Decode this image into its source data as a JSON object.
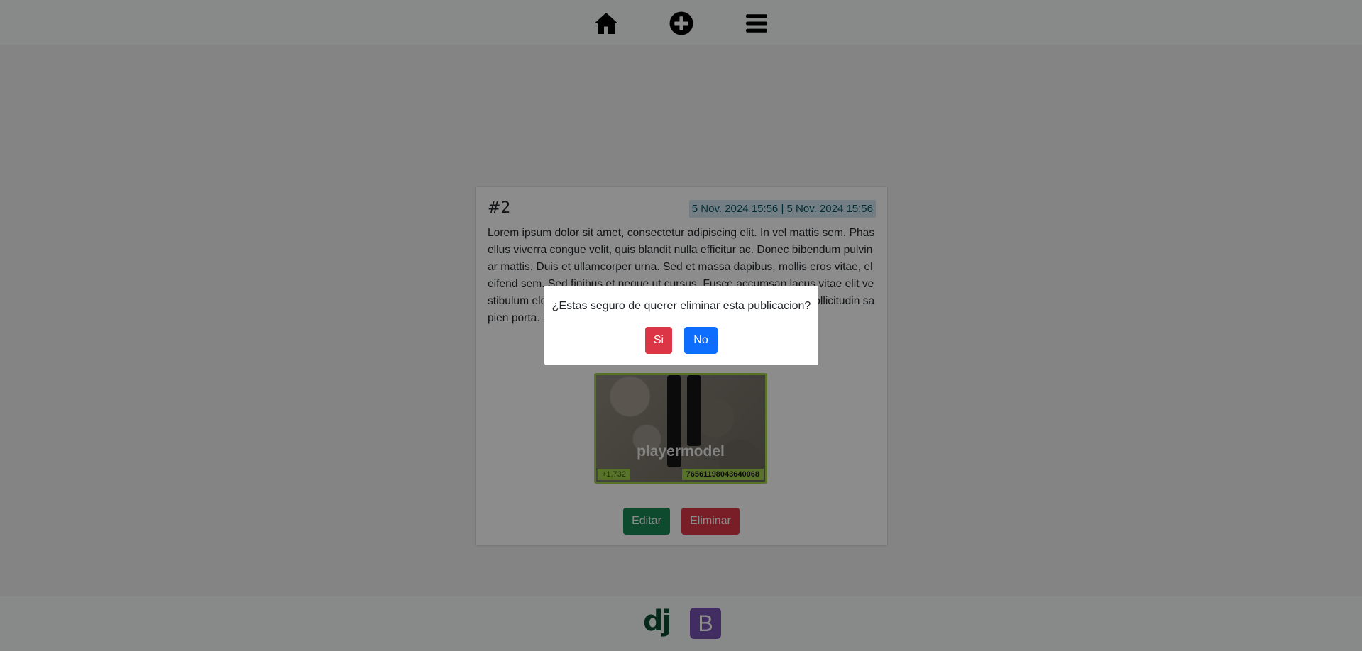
{
  "nav": {
    "icons": [
      "home-icon",
      "plus-circle-icon",
      "hamburger-menu-icon"
    ]
  },
  "post": {
    "number": "#2",
    "dates": "5 Nov. 2024 15:56 | 5 Nov. 2024 15:56",
    "body": "Lorem ipsum dolor sit amet, consectetur adipiscing elit. In vel mattis sem. Phasellus viverra congue velit, quis blandit nulla efficitur ac. Donec bibendum pulvinar mattis. Duis et ullamcorper urna. Sed et massa dapibus, mollis eros vitae, eleifend sem. Sed finibus et neque ut cursus. Fusce accumsan lacus vitae elit vestibulum eleifend. Sed ultrices leo consectetur sem gravida, vitae sollicitudin sapien porta. Suspendisse potenti.",
    "image": {
      "caption": "playermodel",
      "badge_left": "+1,732",
      "badge_right": "76561198043640068",
      "border_color": "#a3d04d"
    },
    "edit_label": "Editar",
    "delete_label": "Eliminar"
  },
  "modal": {
    "question": "¿Estas seguro de querer eliminar esta publicacion?",
    "yes_label": "Si",
    "no_label": "No"
  },
  "footer": {
    "django_logo": "dj",
    "bootstrap_logo": "B"
  },
  "colors": {
    "success": "#198754",
    "danger": "#dc3545",
    "primary": "#0d6efd",
    "info_bg": "#cfe6ee",
    "bootstrap_purple": "#7952b3",
    "django_green": "#0c4b33"
  }
}
